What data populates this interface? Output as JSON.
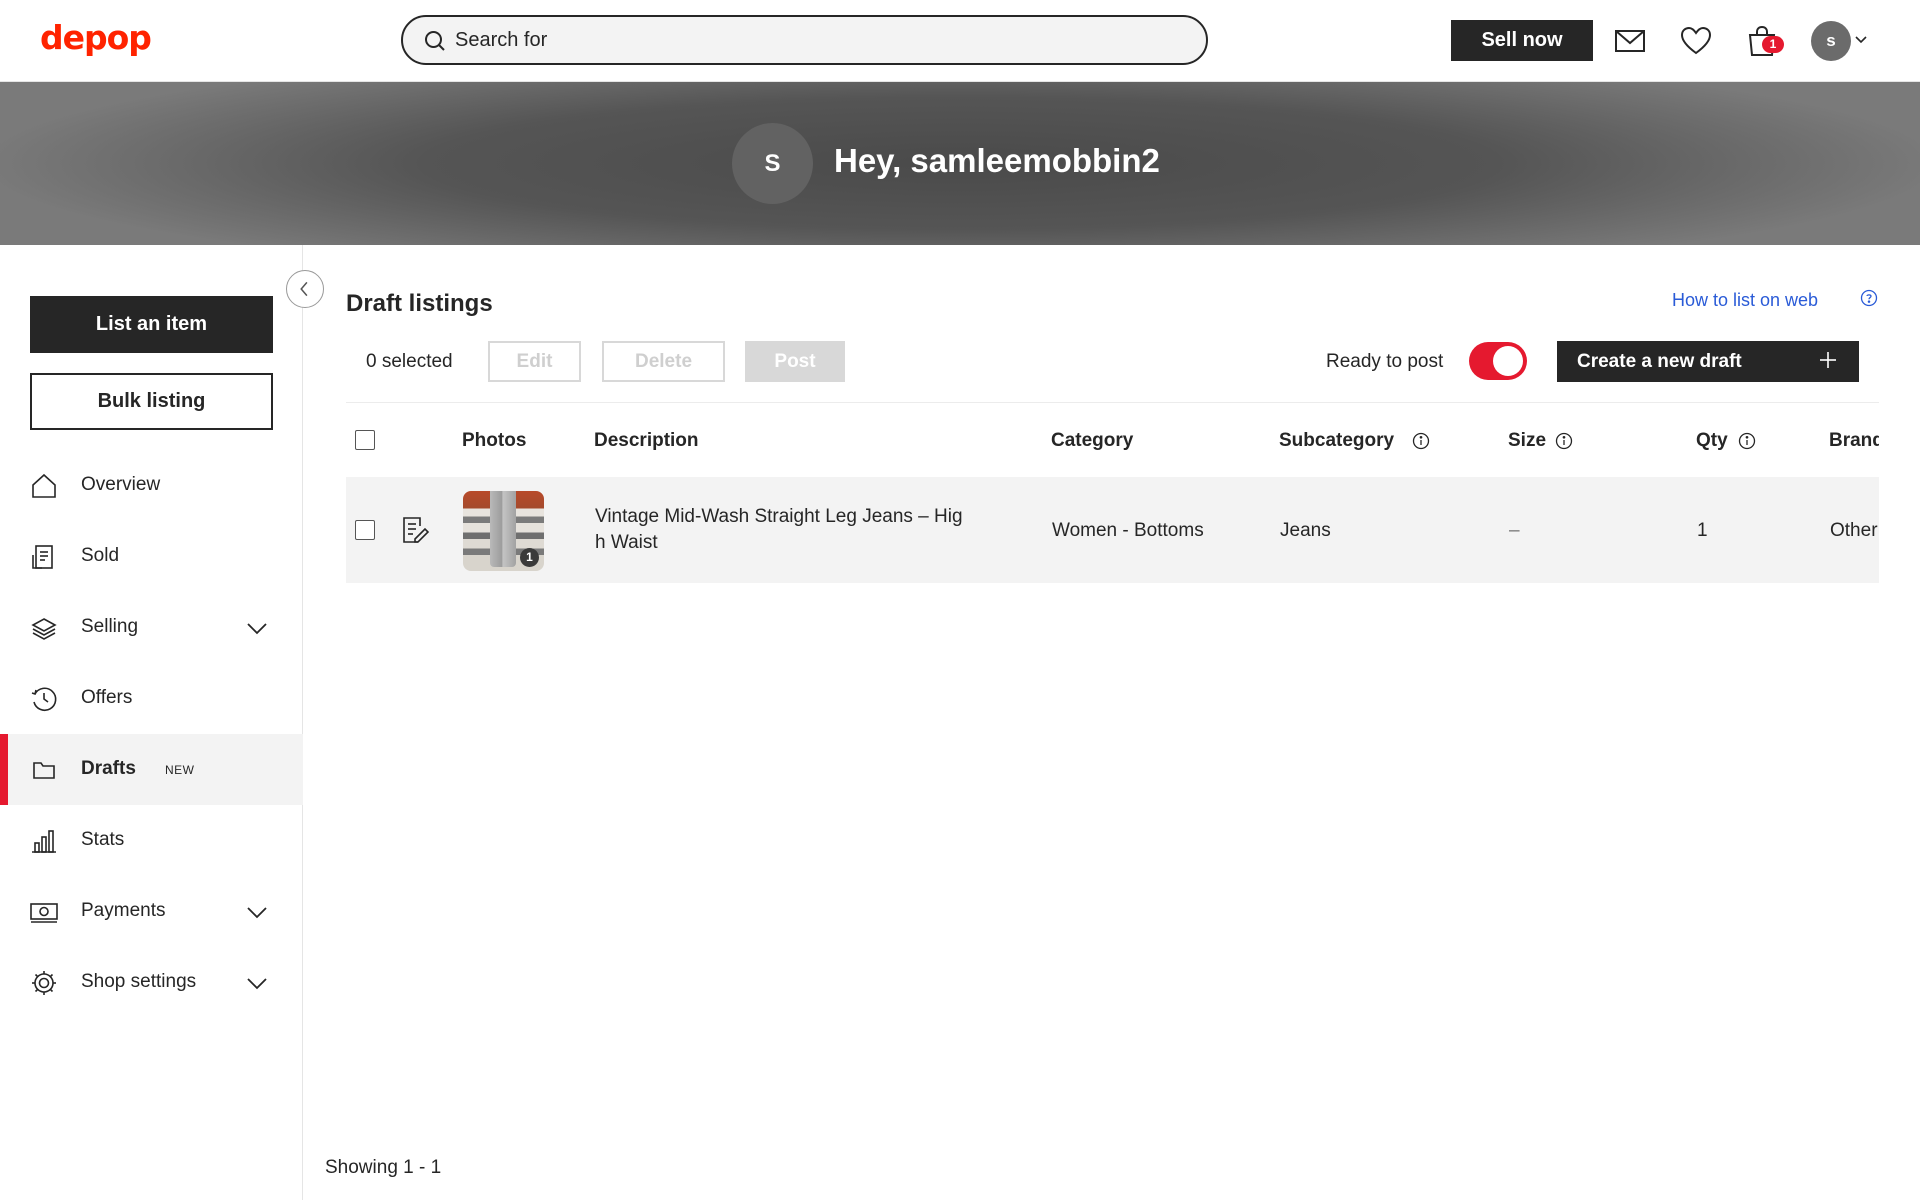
{
  "header": {
    "logo": "depop",
    "search_placeholder": "Search for",
    "sell_label": "Sell now",
    "cart_count": "1",
    "avatar_initial": "s"
  },
  "banner": {
    "avatar_initial": "S",
    "greeting": "Hey, samleemobbin2"
  },
  "sidebar": {
    "list_item_label": "List an item",
    "bulk_listing_label": "Bulk listing",
    "items": [
      {
        "label": "Overview",
        "icon": "home-icon"
      },
      {
        "label": "Sold",
        "icon": "receipt-icon"
      },
      {
        "label": "Selling",
        "icon": "layers-icon",
        "expandable": true
      },
      {
        "label": "Offers",
        "icon": "offers-clock-icon"
      },
      {
        "label": "Drafts",
        "icon": "folder-icon",
        "active": true,
        "tag": "NEW"
      },
      {
        "label": "Stats",
        "icon": "bar-chart-icon"
      },
      {
        "label": "Payments",
        "icon": "banknote-icon",
        "expandable": true
      },
      {
        "label": "Shop settings",
        "icon": "gear-icon",
        "expandable": true
      }
    ]
  },
  "main": {
    "title": "Draft listings",
    "how_to_label": "How to list on web",
    "selected_text": "0 selected",
    "edit_label": "Edit",
    "delete_label": "Delete",
    "post_label": "Post",
    "ready_label": "Ready to post",
    "ready_toggle_on": true,
    "create_label": "Create a new draft",
    "columns": [
      "Photos",
      "Description",
      "Category",
      "Subcategory",
      "Size",
      "Qty",
      "Brand"
    ],
    "rows": [
      {
        "photo_count": "1",
        "description_line1": "Vintage Mid-Wash Straight Leg Jeans – Hig",
        "description_line2": "h Waist",
        "category": "Women - Bottoms",
        "subcategory": "Jeans",
        "size": "–",
        "qty": "1",
        "brand": "Other"
      }
    ],
    "showing": "Showing 1 - 1"
  },
  "colors": {
    "brand_red": "#ff2300",
    "accent_red": "#e5192f",
    "dark": "#262626",
    "link_blue": "#2a5bd7"
  }
}
